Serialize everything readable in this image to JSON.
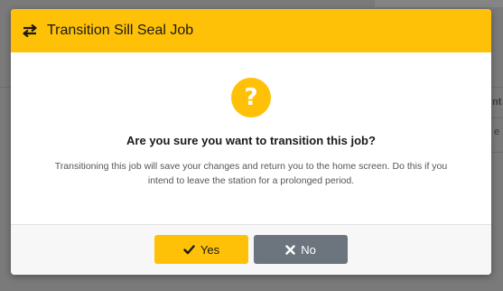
{
  "background": {
    "right_text_1": "nt",
    "right_text_2": "e"
  },
  "dialog": {
    "title": "Transition Sill Seal Job",
    "title_icon": "exchange-icon",
    "question_icon": "question-icon",
    "question": "Are you sure you want to transition this job?",
    "description": "Transitioning this job will save your changes and return you to the home screen. Do this if you intend to leave the station for a prolonged period.",
    "yes_label": "Yes",
    "yes_icon": "check-icon",
    "no_label": "No",
    "no_icon": "close-icon"
  },
  "colors": {
    "accent": "#ffc107",
    "secondary": "#6c757d"
  }
}
